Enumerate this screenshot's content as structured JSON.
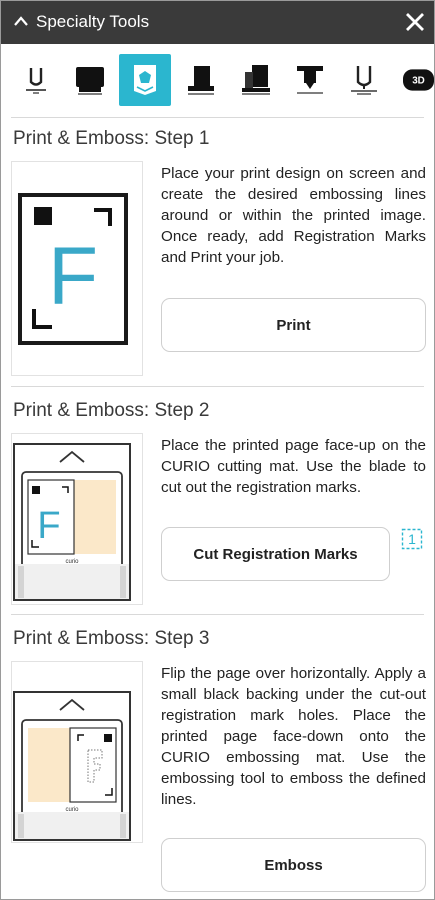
{
  "header": {
    "title": "Specialty Tools"
  },
  "toolbar": {
    "tools": [
      {
        "icon": "emboss-tool-icon",
        "active": false
      },
      {
        "icon": "print-tool-icon",
        "active": false
      },
      {
        "icon": "print-emboss-icon",
        "active": true
      },
      {
        "icon": "stipple-tool-icon",
        "active": false
      },
      {
        "icon": "layer-tool-icon",
        "active": false
      },
      {
        "icon": "foil-tool-icon",
        "active": false
      },
      {
        "icon": "pen-tool-icon",
        "active": false
      },
      {
        "icon": "3d-tool-icon",
        "active": false
      }
    ],
    "third_d_label": "3D"
  },
  "steps": [
    {
      "title": "Print & Emboss: Step 1",
      "description": "Place your print design on screen and create the desired embossing lines around or within the printed image. Once ready, add Registration Marks and Print your job.",
      "button": "Print",
      "thumb_letter": "F"
    },
    {
      "title": "Print & Emboss: Step 2",
      "description": "Place the printed page face-up on the CURIO cutting mat. Use the blade to cut out the registration marks.",
      "button": "Cut Registration Marks",
      "thumb_letter": "F",
      "mat_label": "curio",
      "help_badge": "1"
    },
    {
      "title": "Print & Emboss: Step 3",
      "description": "Flip the page over horizontally. Apply a small black backing under the cut-out registration mark holes. Place the printed page face-down onto the CURIO embossing mat. Use the embossing tool to emboss the defined lines.",
      "button": "Emboss",
      "mat_label": "curio"
    }
  ],
  "colors": {
    "accent": "#2bb6cf",
    "letter_blue": "#3aa8c8",
    "paper_peach": "#fbe8c9",
    "titlebar": "#3a3a3a"
  }
}
